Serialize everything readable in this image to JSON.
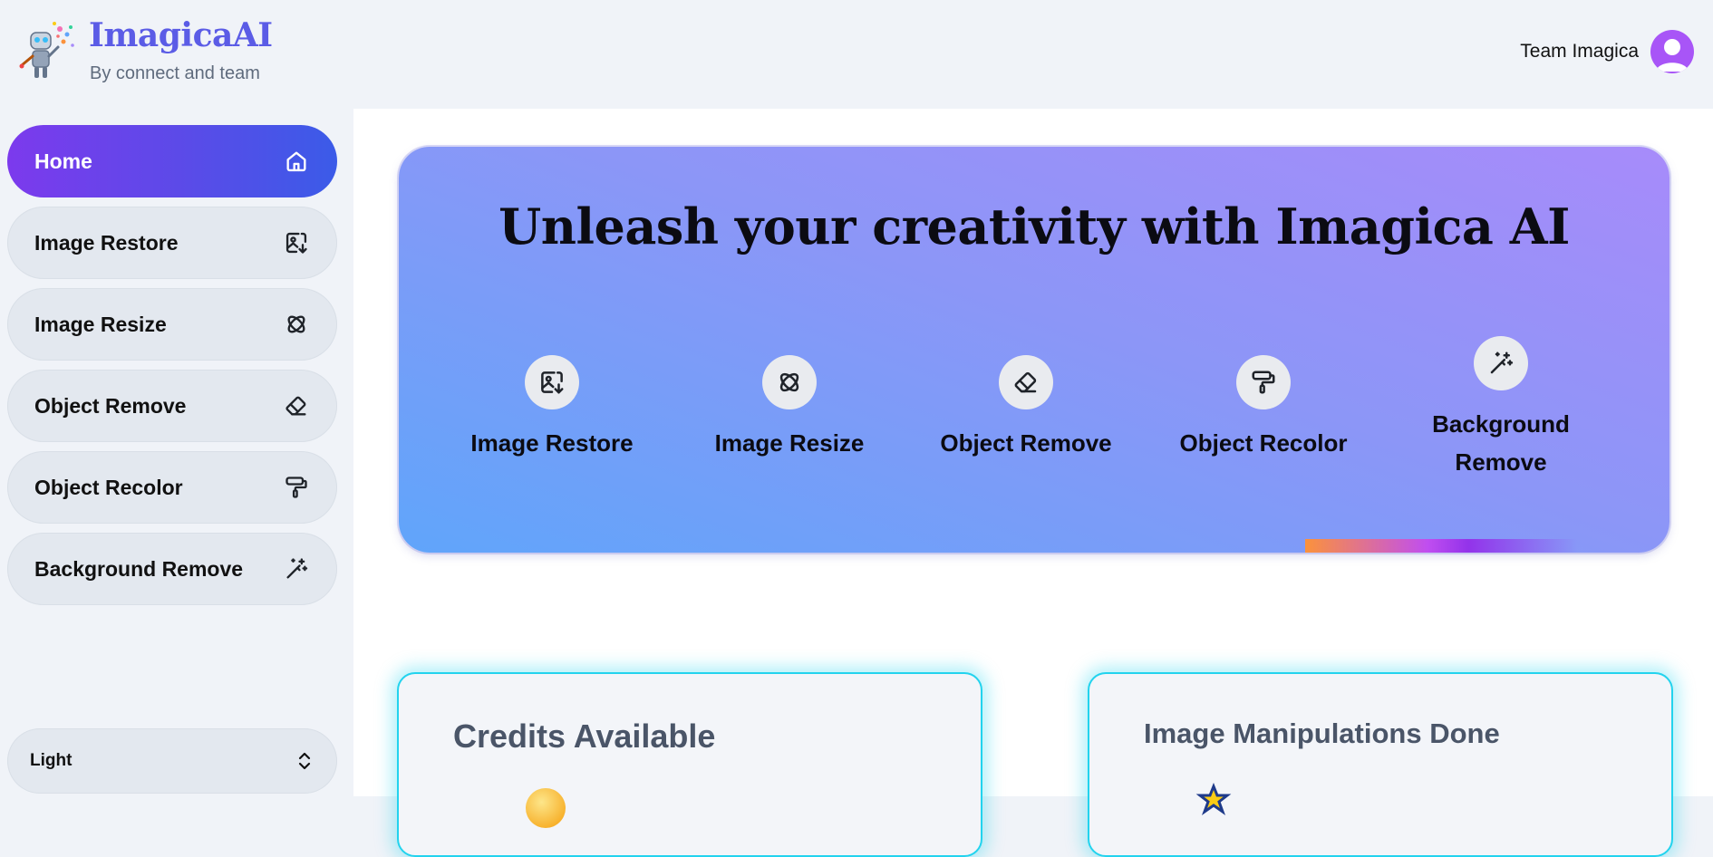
{
  "header": {
    "brand_title": "ImagicaAI",
    "brand_subtitle": "By connect and team",
    "user_name": "Team Imagica"
  },
  "sidebar": {
    "items": [
      {
        "label": "Home",
        "icon": "home-icon",
        "active": true
      },
      {
        "label": "Image Restore",
        "icon": "image-restore-icon",
        "active": false
      },
      {
        "label": "Image Resize",
        "icon": "resize-icon",
        "active": false
      },
      {
        "label": "Object Remove",
        "icon": "eraser-icon",
        "active": false
      },
      {
        "label": "Object Recolor",
        "icon": "paint-roller-icon",
        "active": false
      },
      {
        "label": "Background Remove",
        "icon": "magic-wand-icon",
        "active": false
      }
    ],
    "theme_select": {
      "value": "Light"
    }
  },
  "hero": {
    "title": "Unleash your creativity with Imagica AI",
    "features": [
      {
        "label": "Image Restore",
        "icon": "image-restore-icon"
      },
      {
        "label": "Image Resize",
        "icon": "resize-icon"
      },
      {
        "label": "Object Remove",
        "icon": "eraser-icon"
      },
      {
        "label": "Object Recolor",
        "icon": "paint-roller-icon"
      },
      {
        "label": "Background Remove",
        "icon": "magic-wand-icon"
      }
    ]
  },
  "cards": {
    "credits_title": "Credits Available",
    "manipulations_title": "Image Manipulations Done"
  },
  "colors": {
    "brand": "#5b5ce6",
    "active_nav_start": "#7c3aed",
    "active_nav_end": "#3b5be8",
    "card_border": "#22d3ee"
  }
}
